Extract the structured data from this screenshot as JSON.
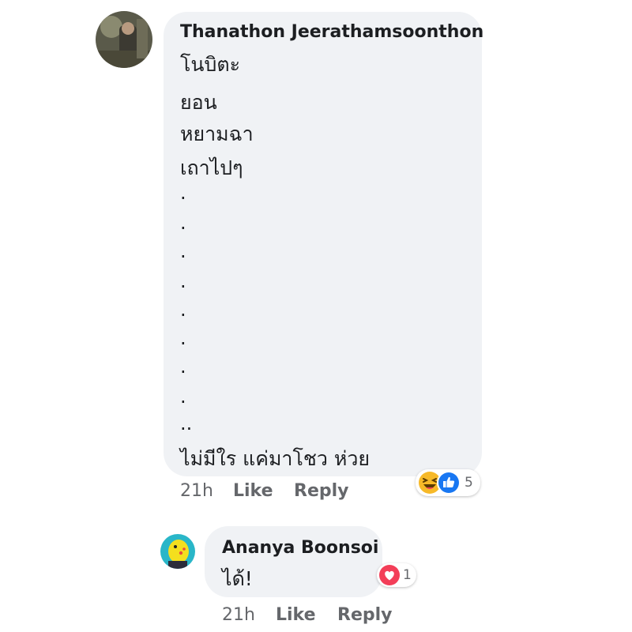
{
  "comment": {
    "author": "Thanathon Jeerathamsoonthon",
    "lines": [
      "โนบิตะ",
      "ยอน",
      "หยามฉา",
      "เถาไปๆ"
    ],
    "dots": [
      ".",
      ".",
      ".",
      ".",
      ".",
      ".",
      ".",
      ".",
      ".."
    ],
    "last_line": "ไม่มีใร แค่มาโชว ห่วย",
    "time": "21h",
    "like_label": "Like",
    "reply_label": "Reply",
    "reactions": {
      "icons": [
        "haha-icon",
        "like-icon"
      ],
      "count": "5"
    }
  },
  "reply": {
    "author": "Ananya Boonsoi",
    "text": "ได้!",
    "time": "21h",
    "like_label": "Like",
    "reply_label": "Reply",
    "reactions": {
      "icons": [
        "love-icon"
      ],
      "count": "1"
    }
  },
  "colors": {
    "bubble": "#f0f2f5",
    "text": "#1c1e21",
    "meta": "#65676b",
    "like_blue": "#1877f2",
    "love_red": "#f33e58",
    "haha_yellow": "#f7b928"
  }
}
